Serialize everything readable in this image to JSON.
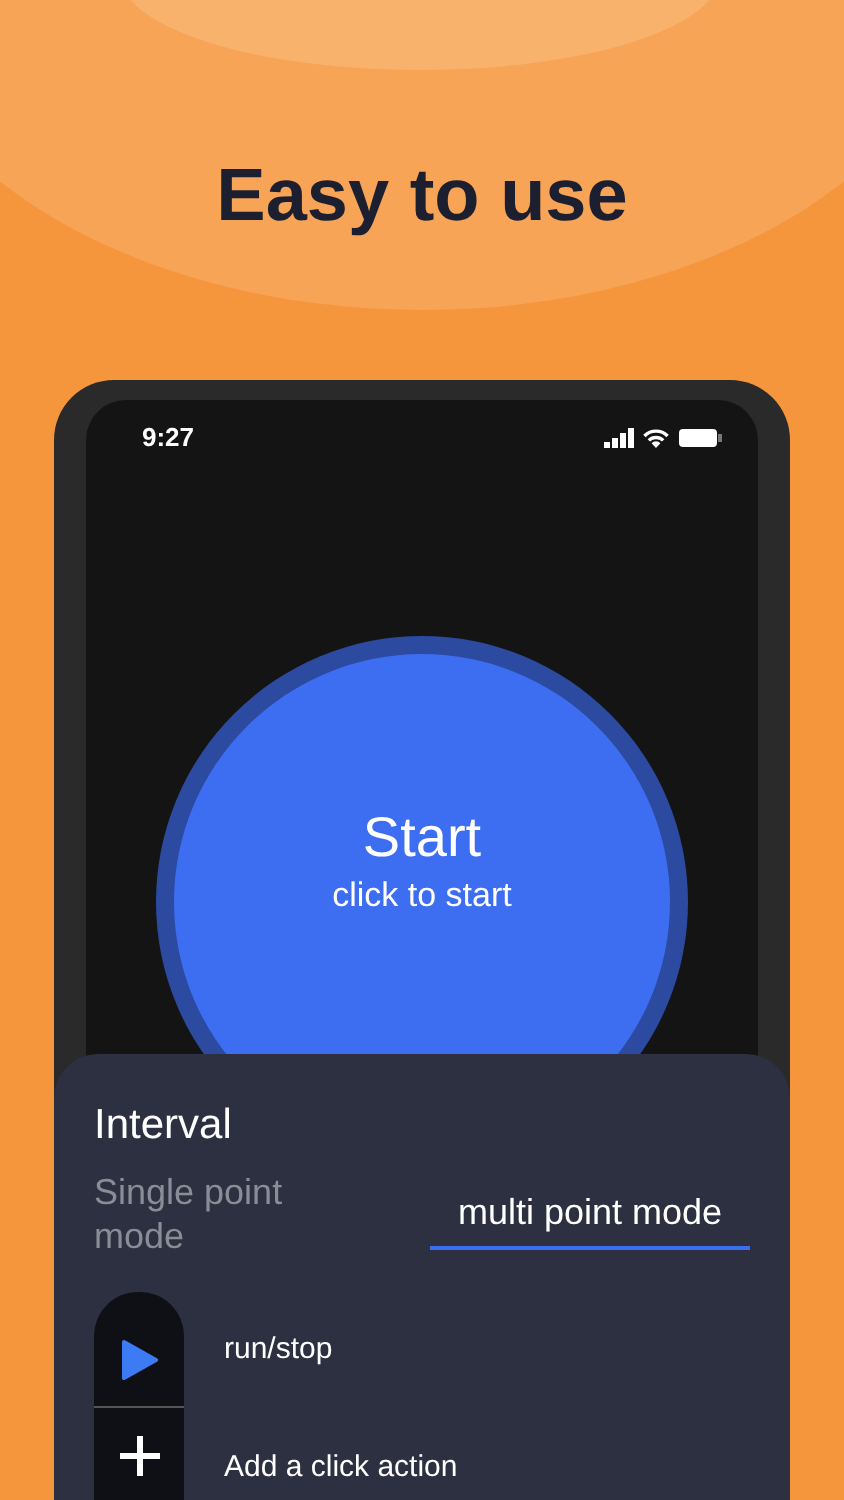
{
  "headline": "Easy to use",
  "status_bar": {
    "time": "9:27"
  },
  "start_button": {
    "label": "Start",
    "sublabel": "click to start"
  },
  "sheet": {
    "title": "Interval",
    "modes": [
      {
        "label": "Single point mode",
        "selected": false
      },
      {
        "label": "multi point mode",
        "selected": true
      }
    ],
    "actions": [
      {
        "kind": "play",
        "label": "run/stop"
      },
      {
        "kind": "add",
        "label": "Add a click action"
      }
    ]
  }
}
